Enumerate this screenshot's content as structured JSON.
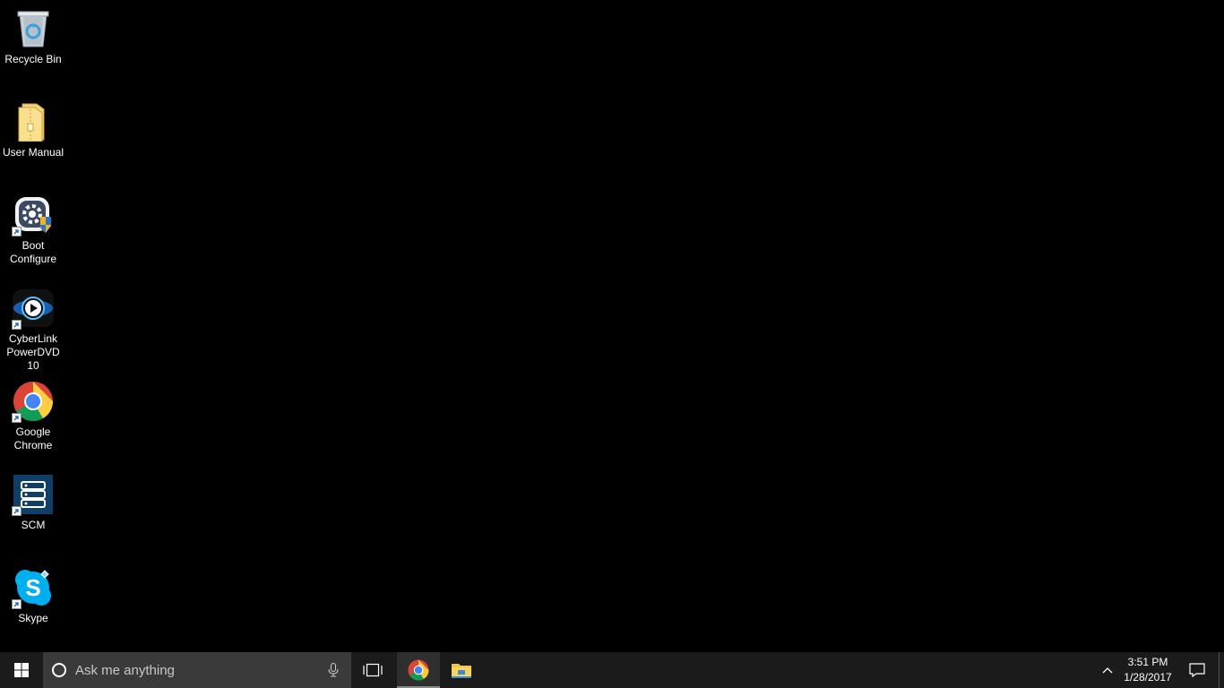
{
  "desktop": {
    "icons": [
      {
        "label": "Recycle Bin",
        "icon": "recycle-bin-icon"
      },
      {
        "label": "User Manual",
        "icon": "folder-icon"
      },
      {
        "label": "Boot Configure",
        "icon": "boot-configure-icon"
      },
      {
        "label": "CyberLink PowerDVD 10",
        "icon": "powerdvd-icon"
      },
      {
        "label": "Google Chrome",
        "icon": "chrome-icon"
      },
      {
        "label": "SCM",
        "icon": "scm-icon"
      },
      {
        "label": "Skype",
        "icon": "skype-icon"
      }
    ]
  },
  "taskbar": {
    "start_icon": "windows-logo-icon",
    "search": {
      "placeholder": "Ask me anything",
      "icon": "cortana-icon",
      "mic_icon": "microphone-icon"
    },
    "task_view_icon": "task-view-icon",
    "pinned": [
      {
        "name": "Google Chrome",
        "icon": "chrome-icon",
        "active": true
      },
      {
        "name": "File Explorer",
        "icon": "file-explorer-icon",
        "active": false
      }
    ],
    "tray": {
      "chevron_icon": "chevron-up-icon",
      "time": "3:51 PM",
      "date": "1/28/2017",
      "action_center_icon": "action-center-icon"
    }
  },
  "colors": {
    "desktop_bg": "#000000",
    "taskbar_bg": "#1b1b1b",
    "search_bg": "#3a3a3a"
  }
}
